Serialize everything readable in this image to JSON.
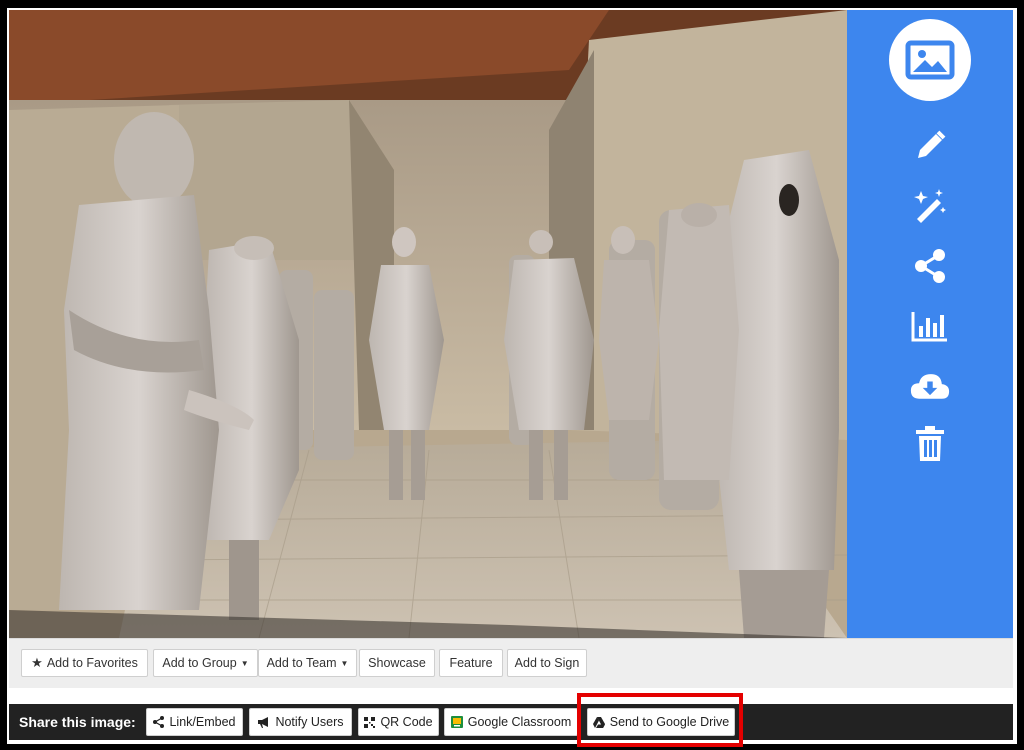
{
  "actions": {
    "favorites": "Add to Favorites",
    "group": "Add to Group",
    "team": "Add to Team",
    "showcase": "Showcase",
    "feature": "Feature",
    "sign": "Add to Sign"
  },
  "share": {
    "label": "Share this image:",
    "link": "Link/Embed",
    "notify": "Notify Users",
    "qr": "QR Code",
    "classroom": "Google Classroom",
    "drive": "Send to Google Drive"
  },
  "sidebar_icons": [
    "image-icon",
    "pencil-icon",
    "magic-wand-icon",
    "share-icon",
    "stats-icon",
    "cloud-download-icon",
    "trash-icon"
  ],
  "colors": {
    "sidebar": "#3d86ee",
    "share_bar": "#222222",
    "highlight": "#e40000"
  }
}
